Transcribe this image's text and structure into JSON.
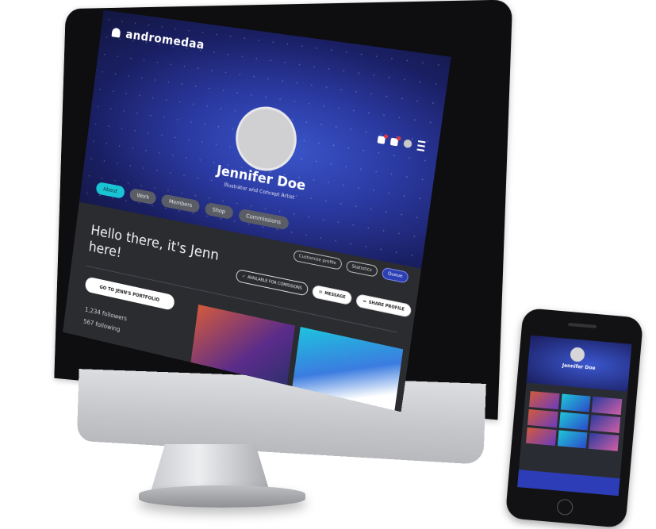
{
  "app": {
    "brand": "andromedaa"
  },
  "profile": {
    "name": "Jennifer Doe",
    "role": "Illustrator and Concept Artist"
  },
  "tabs": [
    {
      "label": "About",
      "active": true
    },
    {
      "label": "Work"
    },
    {
      "label": "Members"
    },
    {
      "label": "Shop"
    },
    {
      "label": "Commissions"
    }
  ],
  "header_actions": {
    "customize": "Customize profile",
    "statistics": "Statistics",
    "queue": "Queue"
  },
  "intro": {
    "greeting": "Hello there, it's Jenn here!"
  },
  "status_actions": {
    "available": "AVAILABLE FOR COMISSIONS",
    "message": "MESSAGE",
    "share": "SHARE PROFILE"
  },
  "portfolio_button": "GO TO JENN'S PORTFOLIO",
  "stats": {
    "followers": "1,234 followers",
    "following": "567 following"
  },
  "colors": {
    "accent": "#19c4d4",
    "banner": "#2b3aa2",
    "surface": "#2b2c30"
  }
}
